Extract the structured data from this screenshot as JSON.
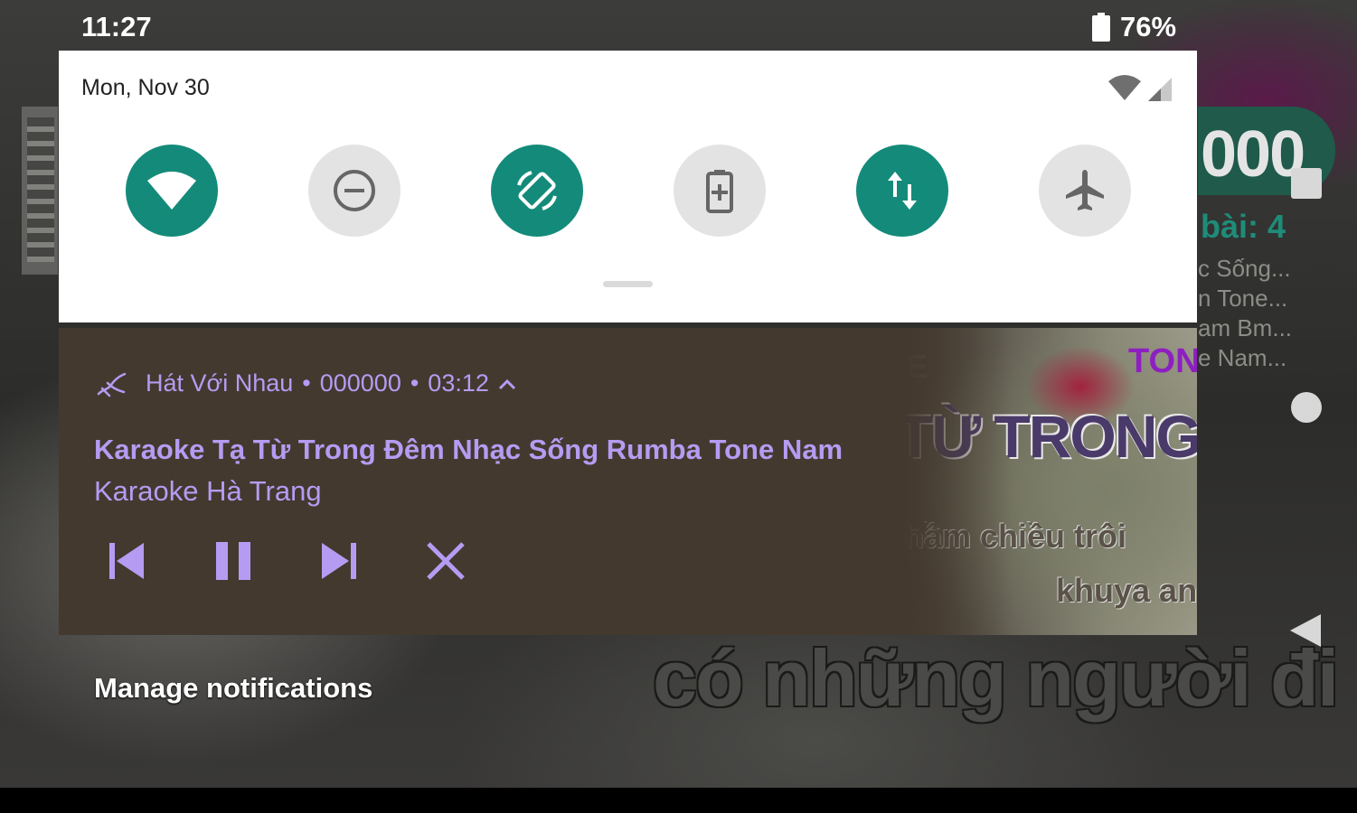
{
  "status_bar": {
    "time": "11:27",
    "battery_percent": "76%"
  },
  "quick_settings": {
    "date": "Mon, Nov 30",
    "tiles": [
      {
        "name": "wifi",
        "icon": "wifi-icon",
        "active": true
      },
      {
        "name": "do-not-disturb",
        "icon": "do-not-disturb-icon",
        "active": false
      },
      {
        "name": "auto-rotate",
        "icon": "auto-rotate-icon",
        "active": true
      },
      {
        "name": "battery-saver",
        "icon": "battery-saver-icon",
        "active": false
      },
      {
        "name": "mobile-data",
        "icon": "mobile-data-icon",
        "active": true
      },
      {
        "name": "airplane-mode",
        "icon": "airplane-icon",
        "active": false
      }
    ],
    "colors": {
      "active": "#148b7a",
      "inactive": "#e3e3e3"
    }
  },
  "media_notification": {
    "app_name": "Hát Với Nhau",
    "subtext": "000000",
    "time": "03:12",
    "title": "Karaoke Tạ Từ Trong Đêm Nhạc Sống Rumba Tone Nam",
    "artist": "Karaoke Hà Trang",
    "accent_color": "#b59cf2",
    "controls": [
      "previous",
      "pause",
      "next",
      "close"
    ],
    "album_art": {
      "tone_label": "TON",
      "letter_label": "E",
      "title_text": "TỪ TRONG Đ",
      "lyric_line_1": "hầm chiều trôi",
      "lyric_line_2": "khuya anh"
    }
  },
  "manage_notifications_label": "Manage notifications",
  "background": {
    "score": "000",
    "song_count": "bài: 4",
    "playlist": [
      "c Sống...",
      "n Tone...",
      "am Bm...",
      "e Nam..."
    ],
    "lyric": "có những người đi"
  }
}
